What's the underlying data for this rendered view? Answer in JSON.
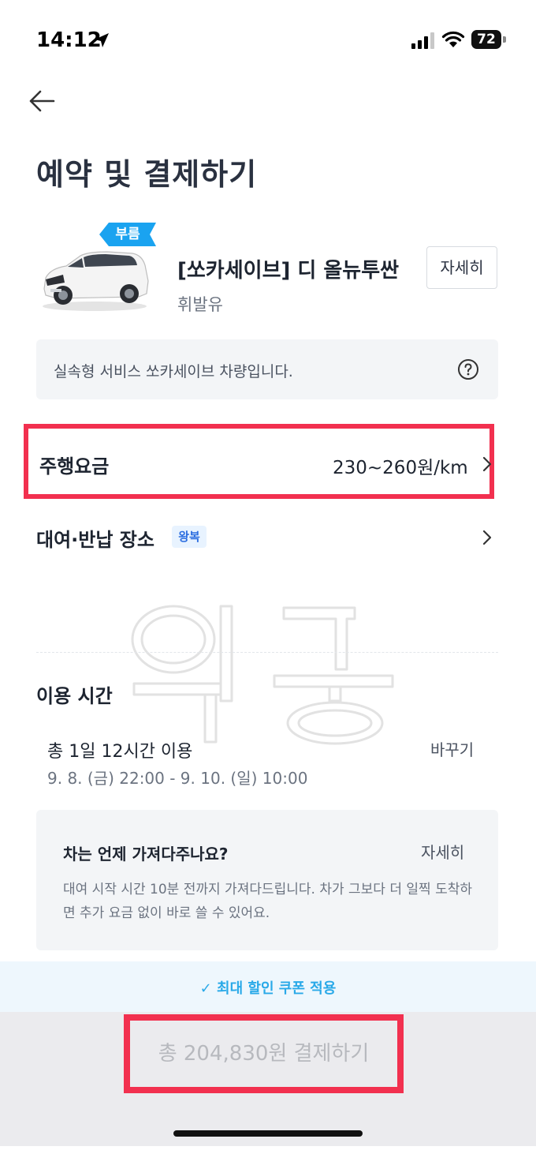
{
  "status_bar": {
    "time": "14:12",
    "battery": "72",
    "icons": [
      "location-arrow-icon",
      "signal-icon",
      "wifi-icon",
      "battery-icon"
    ]
  },
  "header": {
    "back_icon": "back-arrow-icon",
    "title": "예약 및 결제하기"
  },
  "car": {
    "badge": "부름",
    "name": "[쏘카세이브] 디 올뉴투싼",
    "fuel": "휘발유",
    "detail_label": "자세히",
    "info_text": "실속형 서비스 쏘카세이브 차량입니다.",
    "help_icon": "question-circle-icon"
  },
  "fare": {
    "label": "주행요금",
    "value": "230~260원/km"
  },
  "place": {
    "label": "대여·반납 장소",
    "badge": "왕복"
  },
  "usage": {
    "title": "이용 시간",
    "total": "총 1일 12시간 이용",
    "range": "9. 8. (금) 22:00 - 9. 10. (일) 10:00",
    "change_label": "바꾸기"
  },
  "delivery": {
    "title": "차는 언제 가져다주나요?",
    "detail_label": "자세히",
    "description": "대여 시작 시간 10분 전까지 가져다드립니다. 차가 그보다 더 일찍 도착하면 추가 요금 없이 바로 쓸 수 있어요."
  },
  "coupon": {
    "text": "✓ 최대 할인 쿠폰 적용"
  },
  "payment": {
    "button_label": "총 204,830원 결제하기"
  },
  "colors": {
    "highlight": "#f2304f",
    "badge_blue": "#1aa3f0",
    "coupon_text": "#29a9e8",
    "round_badge_text": "#2c6ee0"
  }
}
